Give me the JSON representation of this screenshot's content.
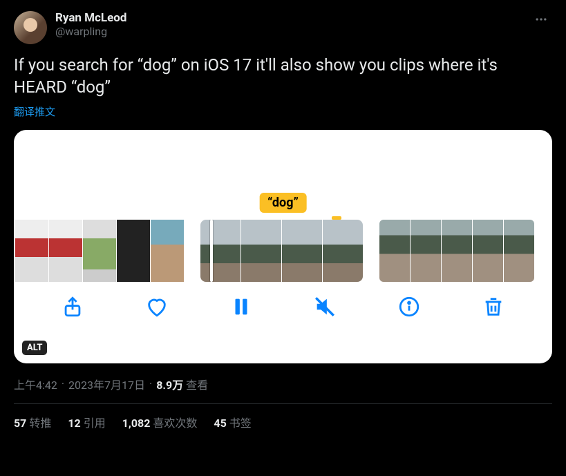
{
  "user": {
    "display_name": "Ryan McLeod",
    "handle": "@warpling"
  },
  "tweet_text": "If you search for “dog” on iOS 17 it'll also show you clips where it's HEARD “dog”",
  "translate_label": "翻译推文",
  "media": {
    "search_tag": "“dog”",
    "alt_label": "ALT"
  },
  "meta": {
    "time": "上午4:42",
    "date": "2023年7月17日",
    "views_number": "8.9万",
    "views_label": "查看"
  },
  "stats": {
    "retweets_num": "57",
    "retweets_label": "转推",
    "quotes_num": "12",
    "quotes_label": "引用",
    "likes_num": "1,082",
    "likes_label": "喜欢次数",
    "bookmarks_num": "45",
    "bookmarks_label": "书签"
  }
}
